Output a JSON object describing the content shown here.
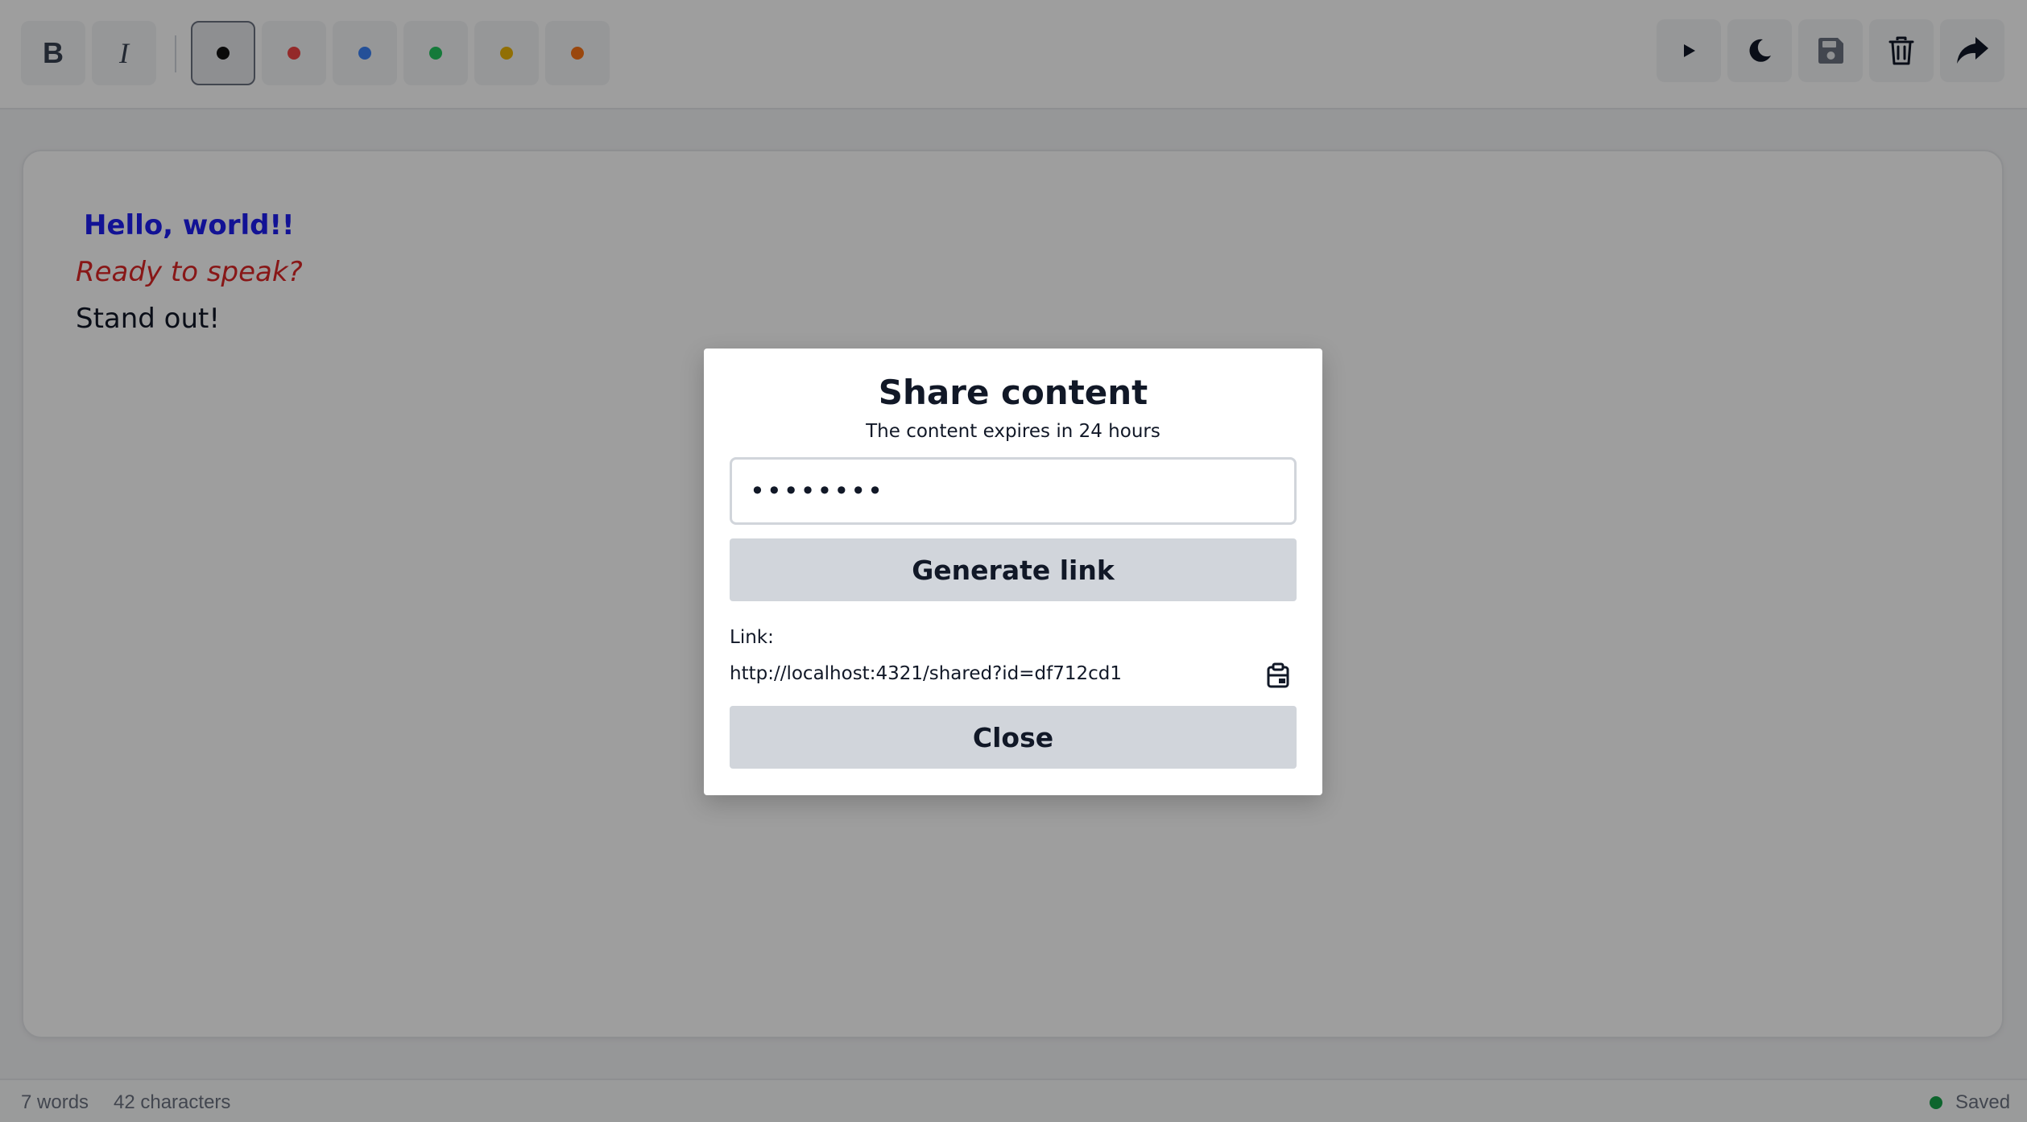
{
  "toolbar": {
    "format_buttons": [
      {
        "label": "B",
        "name": "bold"
      },
      {
        "label": "I",
        "name": "italic"
      }
    ],
    "colors": [
      {
        "name": "black",
        "hex": "#111111",
        "active": true
      },
      {
        "name": "red",
        "hex": "#ef4444",
        "active": false
      },
      {
        "name": "blue",
        "hex": "#3b82f6",
        "active": false
      },
      {
        "name": "green",
        "hex": "#22c55e",
        "active": false
      },
      {
        "name": "yellow",
        "hex": "#eab308",
        "active": false
      },
      {
        "name": "orange",
        "hex": "#f97316",
        "active": false
      }
    ],
    "actions": [
      "play-icon",
      "moon-icon",
      "save-icon",
      "trash-icon",
      "share-icon"
    ]
  },
  "editor": {
    "lines": [
      {
        "text": "Hello, world!!",
        "color": "#1d1df0",
        "style": "bold"
      },
      {
        "text": "Ready to speak?",
        "color": "#dc2626",
        "style": "italic"
      },
      {
        "text": "Stand out!",
        "color": "#111827",
        "style": "normal"
      }
    ]
  },
  "status": {
    "words": "7 words",
    "characters": "42 characters",
    "saved": "Saved",
    "saved_color": "#16a34a"
  },
  "modal": {
    "title": "Share content",
    "subtitle": "The content expires in 24 hours",
    "password_value": "••••••••",
    "generate_label": "Generate link",
    "link_label": "Link:",
    "link_url": "http://localhost:4321/shared?id=df712cd1",
    "close_label": "Close"
  }
}
